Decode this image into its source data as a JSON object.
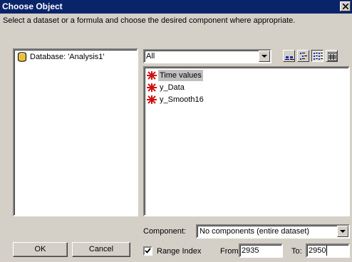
{
  "window": {
    "title": "Choose Object"
  },
  "instruction": "Select a dataset or a formula and choose the desired component where appropriate.",
  "database_tree": {
    "items": [
      {
        "label": "Database: 'Analysis1'",
        "icon": "database-icon"
      }
    ]
  },
  "filter": {
    "selected": "All"
  },
  "toolbar": {
    "buttons": [
      "large-icons-view",
      "small-icons-view",
      "list-view",
      "details-view"
    ]
  },
  "dataset_list": {
    "items": [
      {
        "label": "Time values",
        "icon": "red-star-icon",
        "selected": true
      },
      {
        "label": "y_Data",
        "icon": "red-star-icon",
        "selected": false
      },
      {
        "label": "y_Smooth16",
        "icon": "red-star-icon",
        "selected": false
      }
    ]
  },
  "component": {
    "label": "Component:",
    "selected": "No components (entire dataset)"
  },
  "buttons": {
    "ok": "OK",
    "cancel": "Cancel"
  },
  "range": {
    "checkbox_label": "Range Index",
    "checked": true,
    "from_label": "From",
    "from_value": "2935",
    "to_label": "To:",
    "to_value": "2950"
  },
  "colors": {
    "titlebar": "#0a246a",
    "face": "#d4d0c8",
    "selection": "#c0c0c0"
  }
}
